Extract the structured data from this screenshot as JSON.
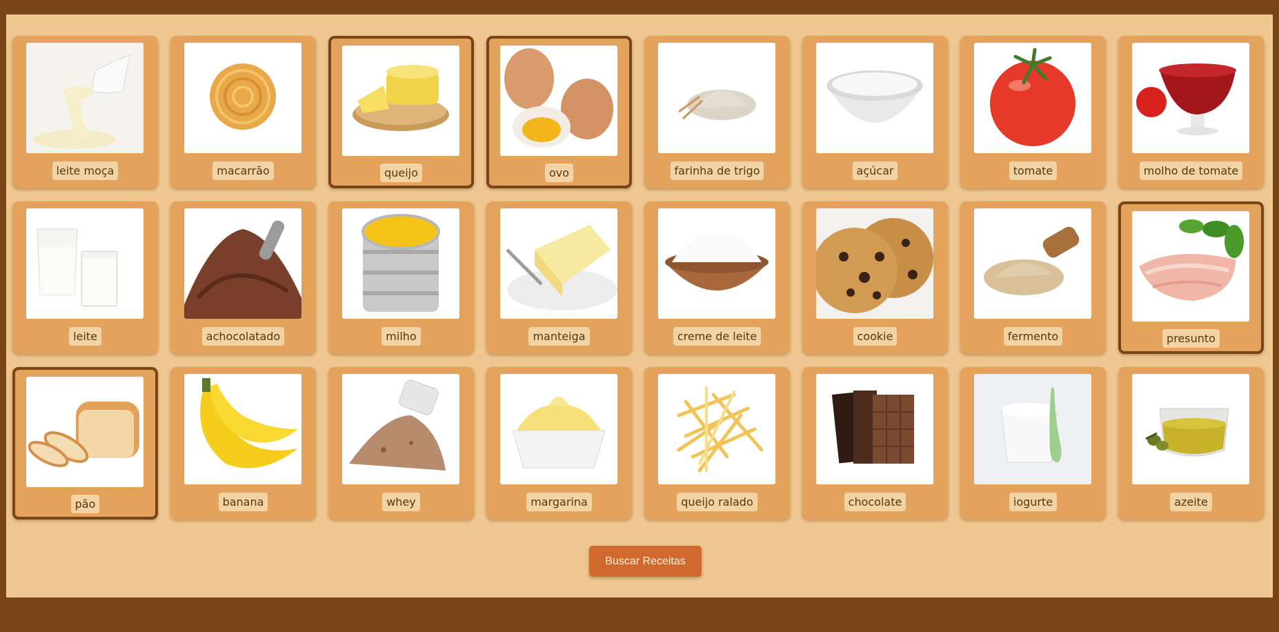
{
  "ingredients": [
    {
      "label": "leite moça",
      "icon": "condensed-milk-icon",
      "selected": false
    },
    {
      "label": "macarrão",
      "icon": "pasta-icon",
      "selected": false
    },
    {
      "label": "queijo",
      "icon": "cheese-icon",
      "selected": true
    },
    {
      "label": "ovo",
      "icon": "egg-icon",
      "selected": true
    },
    {
      "label": "farinha de trigo",
      "icon": "flour-icon",
      "selected": false
    },
    {
      "label": "açúcar",
      "icon": "sugar-icon",
      "selected": false
    },
    {
      "label": "tomate",
      "icon": "tomato-icon",
      "selected": false
    },
    {
      "label": "molho de tomate",
      "icon": "tomato-sauce-icon",
      "selected": false
    },
    {
      "label": "leite",
      "icon": "milk-icon",
      "selected": false
    },
    {
      "label": "achocolatado",
      "icon": "chocolate-powder-icon",
      "selected": false
    },
    {
      "label": "milho",
      "icon": "corn-icon",
      "selected": false
    },
    {
      "label": "manteiga",
      "icon": "butter-icon",
      "selected": false
    },
    {
      "label": "creme de leite",
      "icon": "cream-icon",
      "selected": false
    },
    {
      "label": "cookie",
      "icon": "cookie-icon",
      "selected": false
    },
    {
      "label": "fermento",
      "icon": "yeast-icon",
      "selected": false
    },
    {
      "label": "presunto",
      "icon": "ham-icon",
      "selected": true
    },
    {
      "label": "pão",
      "icon": "bread-icon",
      "selected": true
    },
    {
      "label": "banana",
      "icon": "banana-icon",
      "selected": false
    },
    {
      "label": "whey",
      "icon": "whey-icon",
      "selected": false
    },
    {
      "label": "margarina",
      "icon": "margarine-icon",
      "selected": false
    },
    {
      "label": "queijo ralado",
      "icon": "grated-cheese-icon",
      "selected": false
    },
    {
      "label": "chocolate",
      "icon": "chocolate-bar-icon",
      "selected": false
    },
    {
      "label": "iogurte",
      "icon": "yogurt-icon",
      "selected": false
    },
    {
      "label": "azeite",
      "icon": "olive-oil-icon",
      "selected": false
    }
  ],
  "actions": {
    "search_label": "Buscar Receitas"
  },
  "colors": {
    "frame": "#7a4419",
    "panel": "#f0c790",
    "card": "#e3a35c",
    "card_selected_border": "#7a4419",
    "label_bg": "#f2d3a4",
    "label_text": "#5a3512",
    "button": "#d0692d"
  }
}
